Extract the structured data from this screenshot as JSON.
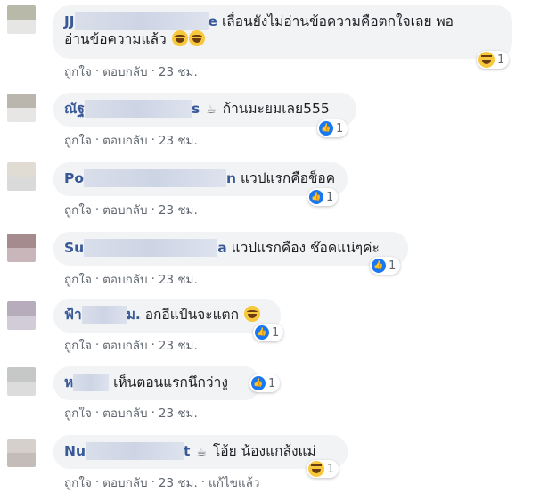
{
  "comments": [
    {
      "name_visible": "JJ",
      "name_tail": "e",
      "text_line1": "เลื่อนยังไม่อ่านข้อความคือตกใจเลย พอ",
      "text_line2": "อ่านข้อความแล้ว",
      "reaction": {
        "icon": "haha-icon",
        "count": "1"
      },
      "like": "ถูกใจ",
      "reply": "ตอบกลับ",
      "time": "23 ชม."
    },
    {
      "name_visible": "ณัฐ",
      "name_tail": "s",
      "text": "ก้านมะยมเลย555",
      "reaction": {
        "icon": "like-icon",
        "count": "1"
      },
      "like": "ถูกใจ",
      "reply": "ตอบกลับ",
      "time": "23 ชม."
    },
    {
      "name_visible": "Po",
      "name_tail": "n",
      "text": "แวปแรกคือช็อค",
      "reaction": {
        "icon": "like-icon",
        "count": "1"
      },
      "like": "ถูกใจ",
      "reply": "ตอบกลับ",
      "time": "23 ชม."
    },
    {
      "name_visible": "Su",
      "name_tail": "a",
      "text": "แวปแรกคือง ช๊อคแน่ๆค่ะ",
      "reaction": {
        "icon": "like-icon",
        "count": "1"
      },
      "like": "ถูกใจ",
      "reply": "ตอบกลับ",
      "time": "23 ชม."
    },
    {
      "name_visible": "ฟ้า",
      "name_tail": "ม.",
      "text": "อกอีแป้นจะแตก",
      "reaction": {
        "icon": "like-icon",
        "count": "1"
      },
      "like": "ถูกใจ",
      "reply": "ตอบกลับ",
      "time": "23 ชม."
    },
    {
      "name_visible": "ห",
      "name_tail": "",
      "text": "เห็นตอนแรกนึกว่างู",
      "reaction": {
        "icon": "like-icon",
        "count": "1"
      },
      "like": "ถูกใจ",
      "reply": "ตอบกลับ",
      "time": "23 ชม."
    },
    {
      "name_visible": "Nu",
      "name_tail": "t",
      "text": "โอ้ย น้องแกล้งแม่",
      "reaction": {
        "icon": "haha-icon",
        "count": "1"
      },
      "like": "ถูกใจ",
      "reply": "ตอบกลับ",
      "time": "23 ชม.",
      "edited": "แก้ไขแล้ว"
    }
  ],
  "colors": {
    "bubble": "#f2f3f5",
    "name": "#385898",
    "meta": "#606770",
    "like_blue": "#1877f2"
  }
}
